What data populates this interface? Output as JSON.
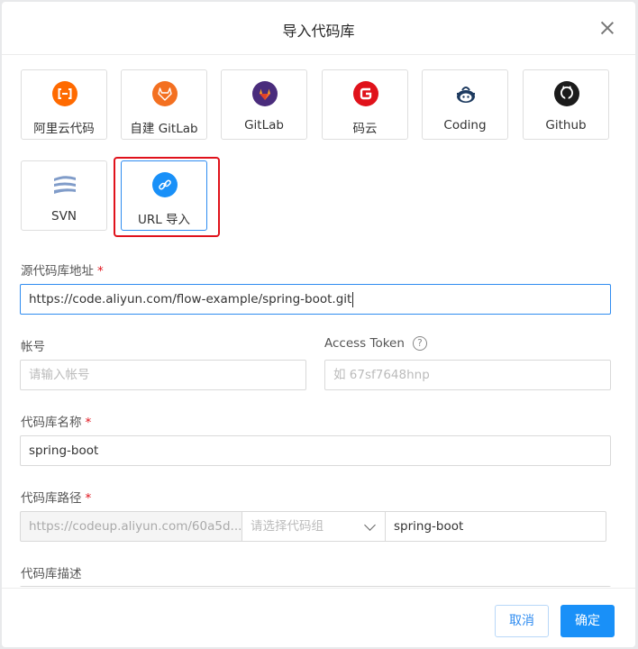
{
  "dialog": {
    "title": "导入代码库"
  },
  "sources": [
    {
      "label": "阿里云代码",
      "icon": "aliyun-icon"
    },
    {
      "label": "自建 GitLab",
      "icon": "gitlab-self-hosted-icon"
    },
    {
      "label": "GitLab",
      "icon": "gitlab-icon"
    },
    {
      "label": "码云",
      "icon": "gitee-icon"
    },
    {
      "label": "Coding",
      "icon": "coding-icon"
    },
    {
      "label": "Github",
      "icon": "github-icon"
    },
    {
      "label": "SVN",
      "icon": "svn-icon"
    },
    {
      "label": "URL 导入",
      "icon": "link-icon",
      "selected": true
    }
  ],
  "form": {
    "source_url": {
      "label": "源代码库地址",
      "required_mark": "*",
      "value": "https://code.aliyun.com/flow-example/spring-boot.git"
    },
    "account": {
      "label": "帐号",
      "placeholder": "请输入帐号"
    },
    "token": {
      "label": "Access Token",
      "help": "?",
      "placeholder": "如 67sf7648hnp"
    },
    "repo_name": {
      "label": "代码库名称",
      "required_mark": "*",
      "value": "spring-boot"
    },
    "repo_path": {
      "label": "代码库路径",
      "required_mark": "*",
      "prefix": "https://codeup.aliyun.com/60a5d...",
      "group_placeholder": "请选择代码组",
      "value": "spring-boot"
    },
    "description": {
      "label": "代码库描述"
    }
  },
  "footer": {
    "cancel": "取消",
    "confirm": "确定"
  },
  "colors": {
    "primary": "#1990f8",
    "required": "#e0121b",
    "highlight": "#e0121b"
  }
}
